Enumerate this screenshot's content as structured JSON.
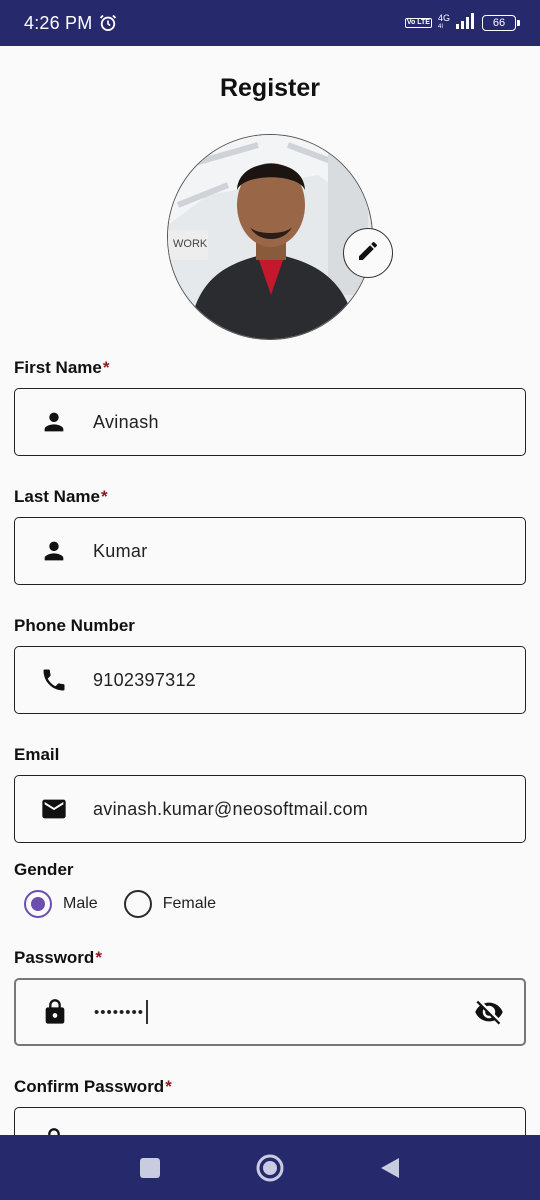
{
  "status_bar": {
    "time": "4:26 PM",
    "volte": "Vo LTE",
    "network": "4G",
    "network_sub": "4I",
    "battery": "66"
  },
  "page": {
    "title": "Register"
  },
  "fields": {
    "first_name": {
      "label": "First Name",
      "required": "*",
      "value": "Avinash",
      "icon": "person-icon"
    },
    "last_name": {
      "label": "Last Name",
      "required": "*",
      "value": "Kumar",
      "icon": "person-icon"
    },
    "phone": {
      "label": "Phone Number",
      "value": "9102397312",
      "icon": "phone-icon"
    },
    "email": {
      "label": "Email",
      "value": "avinash.kumar@neosoftmail.com",
      "icon": "mail-icon"
    },
    "password": {
      "label": "Password",
      "required": "*",
      "value": "••••••••",
      "icon": "lock-icon",
      "visibility_icon": "visibility-off-icon"
    },
    "confirm_password": {
      "label": "Confirm Password",
      "required": "*",
      "icon": "lock-icon"
    }
  },
  "gender": {
    "label": "Gender",
    "options": [
      {
        "label": "Male",
        "selected": true
      },
      {
        "label": "Female",
        "selected": false
      }
    ]
  },
  "colors": {
    "status_bar": "#26296b",
    "radio_accent": "#6a4fb0",
    "required": "#8b1a1a"
  }
}
